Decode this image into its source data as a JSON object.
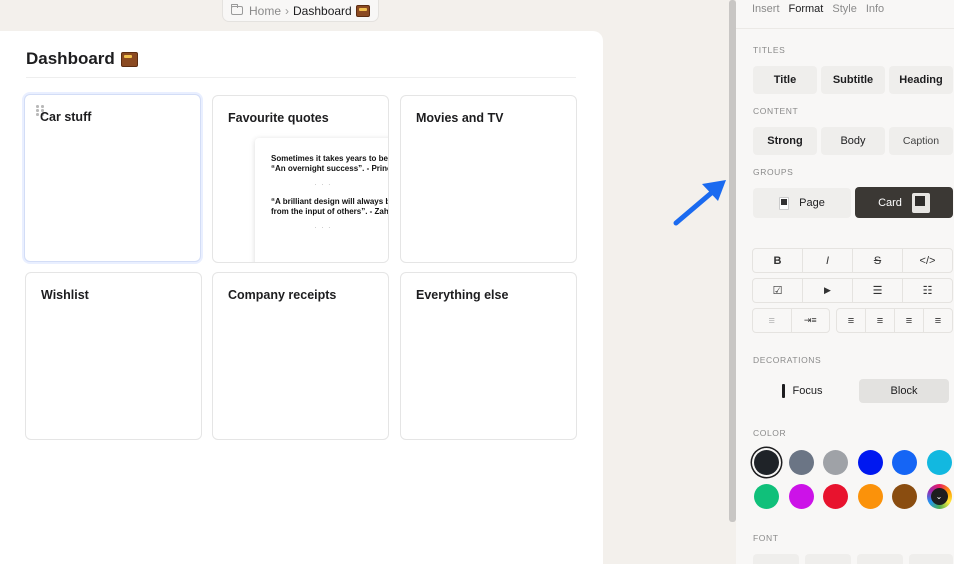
{
  "breadcrumb": {
    "home": "Home",
    "separator": "›",
    "current": "Dashboard"
  },
  "page": {
    "title": "Dashboard"
  },
  "cards": [
    {
      "title": "Car stuff"
    },
    {
      "title": "Favourite quotes"
    },
    {
      "title": "Movies and TV"
    },
    {
      "title": "Wishlist"
    },
    {
      "title": "Company receipts"
    },
    {
      "title": "Everything else"
    }
  ],
  "quotes": {
    "q1_line1": "Sometimes it takes years to bec",
    "q1_line2": "“An overnight success”. - Prince",
    "q2_line1": "“A brilliant design will always be",
    "q2_line2": "from the input of others”. - Zaha",
    "separator": "· · ·"
  },
  "panel": {
    "tabs": [
      "Insert",
      "Format",
      "Style",
      "Info"
    ],
    "sections": {
      "titles": "TITLES",
      "content": "CONTENT",
      "groups": "GROUPS",
      "decorations": "DECORATIONS",
      "color": "COLOR",
      "font": "FONT"
    },
    "titles": [
      "Title",
      "Subtitle",
      "Heading"
    ],
    "content": [
      "Strong",
      "Body",
      "Caption"
    ],
    "groups": {
      "page": "Page",
      "card": "Card"
    },
    "format_row1": [
      "B",
      "I",
      "S",
      "</>"
    ],
    "format_row2": [
      "☑",
      "▶",
      "☰",
      "☷"
    ],
    "format_row3a": [
      "≡",
      "⇥≡"
    ],
    "format_row3b": [
      "≡",
      "≡",
      "≡",
      "≡"
    ],
    "decorations": {
      "focus": "Focus",
      "block": "Block"
    },
    "colors": [
      "#1f2328",
      "#6b7585",
      "#9fa2a7",
      "#0018f0",
      "#1565f5",
      "#12b8e0",
      "#10c07a",
      "#cc12e8",
      "#e8132e",
      "#fb920a",
      "#8a4d10"
    ],
    "custom_color_icon": "chevron-down-icon"
  },
  "accent": "#1a6af0"
}
